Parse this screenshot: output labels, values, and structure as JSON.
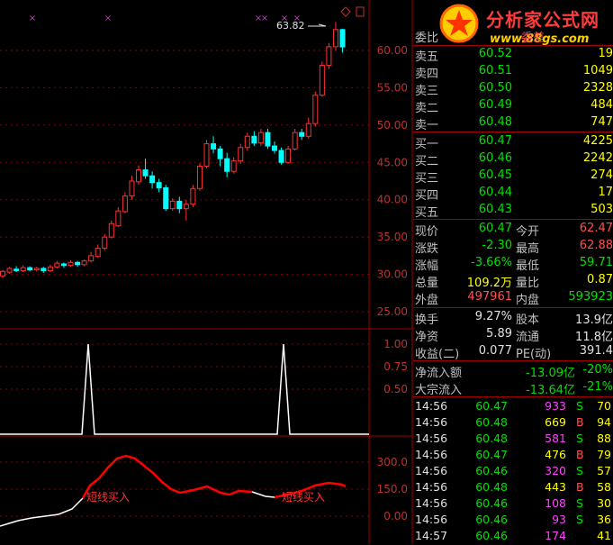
{
  "colors": {
    "up": "#ff3030",
    "down": "#00ffff",
    "grid": "#8b0000",
    "text": "#d0d0d0",
    "green": "#00e000",
    "yellow": "#ffff00",
    "indicator": "#ffffff",
    "magenta": "#c040c0"
  },
  "logo": {
    "title": "分析家公式网",
    "url": "www.88gs.com",
    "icon": "star-badge-icon"
  },
  "chart": {
    "price_axis": [
      "60.00",
      "55.00",
      "50.00",
      "45.00",
      "40.00",
      "35.00",
      "30.00",
      "25.00"
    ],
    "peak_label": "63.82",
    "mid_axis": [
      "1.00",
      "0.75",
      "0.50"
    ],
    "bottom_axis": [
      "300.0",
      "150.0",
      "0.00"
    ],
    "signal_label_1": "短线买入",
    "signal_label_2": "短线买入",
    "icons": [
      "diamond-icon",
      "square-icon"
    ],
    "candles": [
      [
        29.8,
        30.4,
        29.5,
        30.6
      ],
      [
        30.3,
        30.8,
        30.1,
        31.0
      ],
      [
        30.7,
        30.5,
        30.3,
        31.1
      ],
      [
        30.5,
        30.9,
        30.3,
        31.2
      ],
      [
        30.9,
        30.6,
        30.4,
        31.1
      ],
      [
        30.6,
        30.8,
        30.4,
        31.0
      ],
      [
        30.8,
        30.5,
        30.2,
        31.0
      ],
      [
        30.5,
        31.0,
        30.3,
        31.3
      ],
      [
        31.0,
        31.5,
        30.8,
        31.8
      ],
      [
        31.4,
        31.2,
        30.9,
        31.6
      ],
      [
        31.2,
        31.6,
        31.0,
        31.9
      ],
      [
        31.6,
        31.3,
        31.0,
        31.8
      ],
      [
        31.3,
        31.8,
        31.1,
        32.0
      ],
      [
        31.8,
        32.5,
        31.6,
        33.0
      ],
      [
        32.4,
        33.5,
        32.2,
        34.0
      ],
      [
        33.5,
        35.0,
        33.2,
        35.4
      ],
      [
        35.0,
        36.8,
        34.8,
        37.2
      ],
      [
        36.5,
        38.5,
        36.3,
        39.0
      ],
      [
        38.4,
        40.5,
        38.2,
        41.0
      ],
      [
        40.5,
        42.5,
        40.0,
        43.2
      ],
      [
        42.4,
        44.0,
        42.0,
        44.6
      ],
      [
        44.0,
        43.2,
        42.8,
        45.5
      ],
      [
        43.2,
        42.3,
        41.5,
        43.8
      ],
      [
        42.3,
        41.6,
        41.0,
        42.8
      ],
      [
        41.6,
        38.8,
        38.5,
        42.0
      ],
      [
        38.8,
        39.8,
        38.5,
        40.2
      ],
      [
        39.8,
        38.8,
        38.2,
        40.4
      ],
      [
        38.8,
        39.4,
        37.2,
        40.0
      ],
      [
        39.4,
        41.5,
        39.0,
        42.0
      ],
      [
        41.5,
        44.5,
        41.2,
        44.9
      ],
      [
        44.5,
        47.5,
        44.2,
        48.0
      ],
      [
        47.5,
        46.8,
        46.2,
        48.5
      ],
      [
        46.8,
        45.5,
        44.5,
        47.2
      ],
      [
        45.5,
        43.8,
        43.0,
        46.3
      ],
      [
        43.8,
        45.2,
        43.5,
        45.7
      ],
      [
        45.2,
        47.0,
        44.8,
        47.5
      ],
      [
        47.0,
        48.5,
        46.6,
        49.0
      ],
      [
        48.5,
        47.6,
        47.2,
        49.2
      ],
      [
        47.6,
        49.0,
        47.2,
        49.5
      ],
      [
        49.0,
        47.2,
        46.8,
        49.5
      ],
      [
        47.2,
        46.6,
        46.2,
        47.8
      ],
      [
        46.6,
        45.0,
        44.7,
        47.0
      ],
      [
        45.0,
        46.8,
        44.8,
        47.2
      ],
      [
        46.8,
        49.0,
        46.6,
        49.5
      ],
      [
        49.0,
        48.5,
        48.0,
        49.5
      ],
      [
        48.5,
        50.2,
        48.2,
        51.0
      ],
      [
        50.2,
        54.0,
        49.8,
        54.5
      ],
      [
        54.0,
        58.0,
        53.8,
        58.5
      ],
      [
        58.0,
        60.5,
        57.5,
        61.0
      ],
      [
        60.5,
        62.8,
        60.0,
        63.82
      ],
      [
        62.8,
        60.47,
        59.71,
        62.88
      ]
    ]
  },
  "quote": {
    "header": {
      "label": "委比",
      "value": "委差"
    },
    "sells": [
      {
        "label": "卖五",
        "price": "60.52",
        "vol": "19"
      },
      {
        "label": "卖四",
        "price": "60.51",
        "vol": "1049"
      },
      {
        "label": "卖三",
        "price": "60.50",
        "vol": "2328"
      },
      {
        "label": "卖二",
        "price": "60.49",
        "vol": "484"
      },
      {
        "label": "卖一",
        "price": "60.48",
        "vol": "747"
      }
    ],
    "buys": [
      {
        "label": "买一",
        "price": "60.47",
        "vol": "4225"
      },
      {
        "label": "买二",
        "price": "60.46",
        "vol": "2242"
      },
      {
        "label": "买三",
        "price": "60.45",
        "vol": "274"
      },
      {
        "label": "买四",
        "price": "60.44",
        "vol": "17"
      },
      {
        "label": "买五",
        "price": "60.43",
        "vol": "503"
      }
    ],
    "stats": {
      "now_l": "现价",
      "now_v": "60.47",
      "open_l": "今开",
      "open_v": "62.47",
      "chg_l": "涨跌",
      "chg_v": "-2.30",
      "high_l": "最高",
      "high_v": "62.88",
      "pct_l": "涨幅",
      "pct_v": "-3.66%",
      "low_l": "最低",
      "low_v": "59.71",
      "vol_l": "总量",
      "vol_v": "109.2万",
      "ratio_l": "量比",
      "ratio_v": "0.87",
      "out_l": "外盘",
      "out_v": "497961",
      "in_l": "内盘",
      "in_v": "593923"
    },
    "fund": {
      "turn_l": "换手",
      "turn_v": "9.27%",
      "cap_l": "股本",
      "cap_v": "13.9亿",
      "net_l": "净资",
      "net_v": "5.89",
      "flow_l": "流通",
      "flow_v": "11.8亿",
      "eps_l": "收益(二)",
      "eps_v": "0.077",
      "pe_l": "PE(动)",
      "pe_v": "391.4"
    },
    "flows": {
      "net_l": "净流入额",
      "net_v": "-13.09亿",
      "net_p": "-20%",
      "big_l": "大宗流入",
      "big_v": "-13.64亿",
      "big_p": "-21%"
    },
    "trades": [
      {
        "t": "14:56",
        "p": "60.47",
        "v": "933",
        "s": "S",
        "n": "70"
      },
      {
        "t": "14:56",
        "p": "60.48",
        "v": "669",
        "s": "B",
        "n": "94"
      },
      {
        "t": "14:56",
        "p": "60.48",
        "v": "581",
        "s": "S",
        "n": "88"
      },
      {
        "t": "14:56",
        "p": "60.47",
        "v": "476",
        "s": "B",
        "n": "79"
      },
      {
        "t": "14:56",
        "p": "60.46",
        "v": "320",
        "s": "S",
        "n": "57"
      },
      {
        "t": "14:56",
        "p": "60.48",
        "v": "443",
        "s": "B",
        "n": "58"
      },
      {
        "t": "14:56",
        "p": "60.46",
        "v": "108",
        "s": "S",
        "n": "30"
      },
      {
        "t": "14:56",
        "p": "60.46",
        "v": "93",
        "s": "S",
        "n": "36"
      },
      {
        "t": "14:57",
        "p": "60.46",
        "v": "174",
        "s": "",
        "n": "41"
      }
    ]
  }
}
